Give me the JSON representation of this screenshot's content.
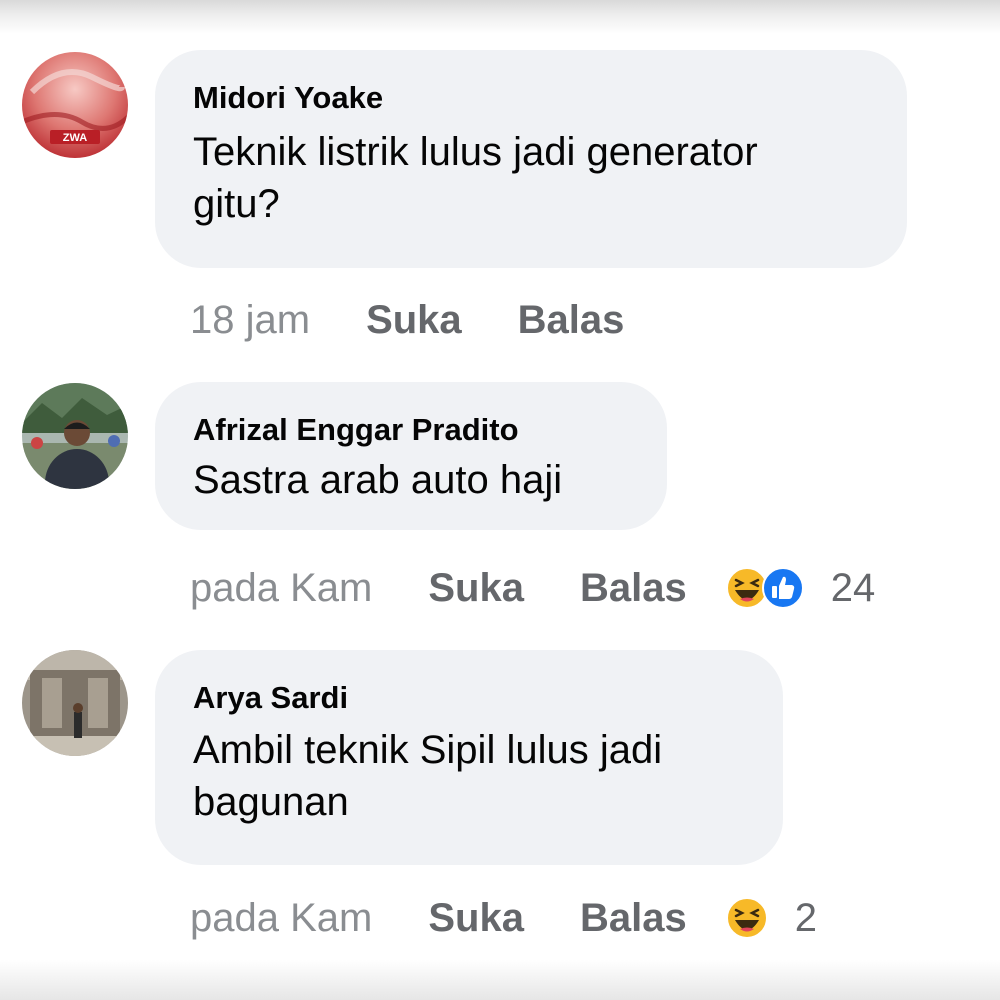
{
  "comments": [
    {
      "author": "Midori Yoake",
      "text": "Teknik listrik lulus jadi generator\ngitu?",
      "time": "18 jam",
      "like_label": "Suka",
      "reply_label": "Balas",
      "avatar_label": "ZWA",
      "reactions": [],
      "reaction_count": ""
    },
    {
      "author": "Afrizal Enggar Pradito",
      "text": "Sastra arab auto haji",
      "time": "pada Kam",
      "like_label": "Suka",
      "reply_label": "Balas",
      "reactions": [
        "haha-icon",
        "like-icon"
      ],
      "reaction_count": "24"
    },
    {
      "author": "Arya Sardi",
      "text": "Ambil teknik Sipil lulus jadi\nbagunan",
      "time": "pada Kam",
      "like_label": "Suka",
      "reply_label": "Balas",
      "reactions": [
        "haha-icon"
      ],
      "reaction_count": "2"
    }
  ],
  "colors": {
    "bubble": "#f0f2f5",
    "meta": "#65676b",
    "like": "#1877f2",
    "haha": "#f7b928"
  }
}
